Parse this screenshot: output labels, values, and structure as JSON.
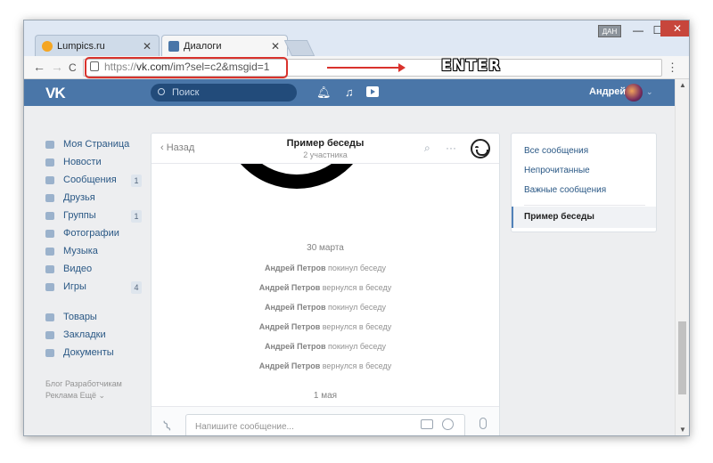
{
  "browser": {
    "tabs": [
      {
        "label": "Lumpics.ru",
        "close": "✕"
      },
      {
        "label": "Диалоги",
        "close": "✕"
      }
    ],
    "lang_indicator": "ДАН",
    "window_buttons": {
      "minimize": "—",
      "maximize": "☐",
      "close": "✕"
    },
    "nav": {
      "back": "←",
      "forward": "→",
      "reload": "C"
    },
    "url": {
      "protocol": "https://",
      "host": "vk.com",
      "path": "/im?sel=c2&msgid=1"
    },
    "annotation": "ENTER",
    "menu": "⋮",
    "colors": {
      "highlight": "#d9322c",
      "vk_blue": "#4a76a8"
    }
  },
  "vk_header": {
    "logo": "VK",
    "search_placeholder": "Поиск",
    "icons": [
      "bell-icon",
      "music-icon",
      "play-icon"
    ],
    "user_name": "Андрей"
  },
  "sidebar": {
    "items": [
      {
        "label": "Моя Страница",
        "icon": "home-icon",
        "badge": ""
      },
      {
        "label": "Новости",
        "icon": "news-icon",
        "badge": ""
      },
      {
        "label": "Сообщения",
        "icon": "chat-icon",
        "badge": "1"
      },
      {
        "label": "Друзья",
        "icon": "person-icon",
        "badge": ""
      },
      {
        "label": "Группы",
        "icon": "group-icon",
        "badge": "1"
      },
      {
        "label": "Фотографии",
        "icon": "camera-icon",
        "badge": ""
      },
      {
        "label": "Музыка",
        "icon": "music-icon",
        "badge": ""
      },
      {
        "label": "Видео",
        "icon": "film-icon",
        "badge": ""
      },
      {
        "label": "Игры",
        "icon": "gamepad-icon",
        "badge": "4"
      },
      {
        "label": "Товары",
        "icon": "bag-icon",
        "badge": ""
      },
      {
        "label": "Закладки",
        "icon": "star-icon",
        "badge": ""
      },
      {
        "label": "Документы",
        "icon": "document-icon",
        "badge": ""
      }
    ],
    "footer_line1": "Блог  Разработчикам",
    "footer_line2": "Реклама  Ещё ⌄"
  },
  "chat": {
    "back_label": "Назад",
    "title": "Пример беседы",
    "subtitle": "2 участника",
    "date1": "30 марта",
    "events": [
      {
        "name": "Андрей Петров",
        "action": "покинул беседу"
      },
      {
        "name": "Андрей Петров",
        "action": "вернулся в беседу"
      },
      {
        "name": "Андрей Петров",
        "action": "покинул беседу"
      },
      {
        "name": "Андрей Петров",
        "action": "вернулся в беседу"
      },
      {
        "name": "Андрей Петров",
        "action": "покинул беседу"
      },
      {
        "name": "Андрей Петров",
        "action": "вернулся в беседу"
      }
    ],
    "date2": "1 мая",
    "input_placeholder": "Напишите сообщение..."
  },
  "right_panel": {
    "items": [
      "Все сообщения",
      "Непрочитанные",
      "Важные сообщения"
    ],
    "active": "Пример беседы"
  }
}
